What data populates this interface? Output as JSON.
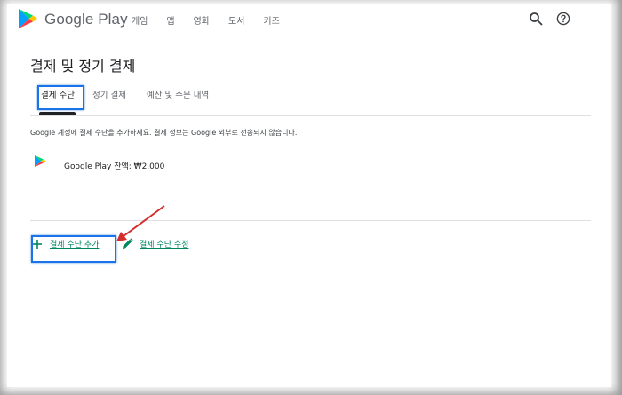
{
  "header": {
    "brand": "Google Play",
    "nav": [
      "게임",
      "앱",
      "영화",
      "도서",
      "키즈"
    ],
    "icons": [
      "search-icon",
      "help-icon"
    ]
  },
  "page": {
    "title": "결제 및 정기 결제"
  },
  "tabs": [
    {
      "label": "결제 수단",
      "active": true
    },
    {
      "label": "정기 결제",
      "active": false
    },
    {
      "label": "예산 및 주문 내역",
      "active": false
    }
  ],
  "description": "Google 계정에 결제 수단을 추가하세요. 결제 정보는 Google 외부로 전송되지 않습니다.",
  "payment_method": {
    "icon": "google-play-icon",
    "label": "Google Play 잔액: ₩2,000"
  },
  "actions": {
    "add_label": "결제 수단 추가",
    "edit_label": "결제 수단 수정"
  },
  "colors": {
    "accent_green": "#01875f",
    "highlight_blue": "#1a73e8",
    "arrow_red": "#d32f2f"
  }
}
